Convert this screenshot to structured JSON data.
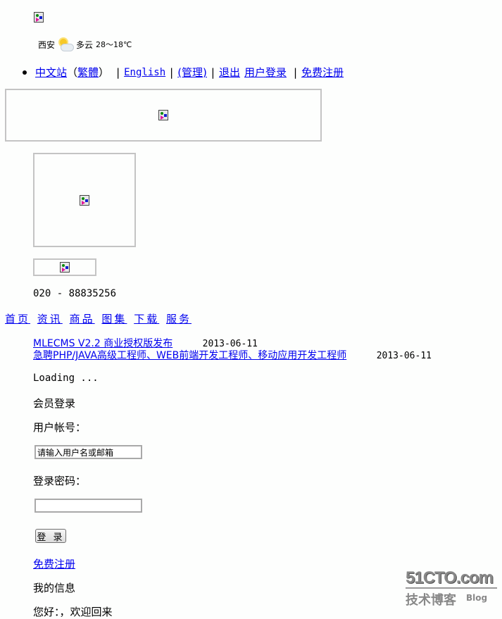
{
  "header": {
    "logo_icon": "broken-image-icon",
    "weather": {
      "city": "西安",
      "icon": "partly-cloudy-icon",
      "condition": "多云",
      "temperature": "28～18℃"
    },
    "top_links": {
      "chinese": "中文站",
      "paren_open": "（",
      "traditional": "繁體",
      "paren_close": "）",
      "sep1": "|",
      "english": "English",
      "sep2": "|",
      "admin": "(管理)",
      "sep3": "|",
      "logout": "退出",
      "user_login": "用户登录",
      "sep4": "|",
      "register": "免费注册"
    },
    "banner_icon": "broken-image-icon",
    "side_image_icon": "broken-image-icon",
    "small_image_icon": "broken-image-icon",
    "phone": "020 - 88835256"
  },
  "main_menu": [
    {
      "label": "首页"
    },
    {
      "label": "资讯"
    },
    {
      "label": "商品"
    },
    {
      "label": "图集"
    },
    {
      "label": "下载"
    },
    {
      "label": "服务"
    }
  ],
  "news": [
    {
      "title": "MLECMS V2.2 商业授权版发布",
      "date": "2013-06-11"
    },
    {
      "title": "急聘PHP/JAVA高级工程师、WEB前端开发工程师、移动应用开发工程师",
      "date": "2013-06-11"
    }
  ],
  "loading_text": "Loading ...",
  "login": {
    "title": "会员登录",
    "username_label": "用户帐号：",
    "username_value": "请输入用户名或邮箱",
    "password_label": "登录密码：",
    "password_value": "",
    "submit_label": "登 录",
    "register_link": "免费注册"
  },
  "my_info": {
    "title": "我的信息",
    "greeting": "您好：，欢迎回来"
  },
  "watermark": {
    "line1": "51CTO.com",
    "line2": "技术博客",
    "line3": "Blog"
  }
}
